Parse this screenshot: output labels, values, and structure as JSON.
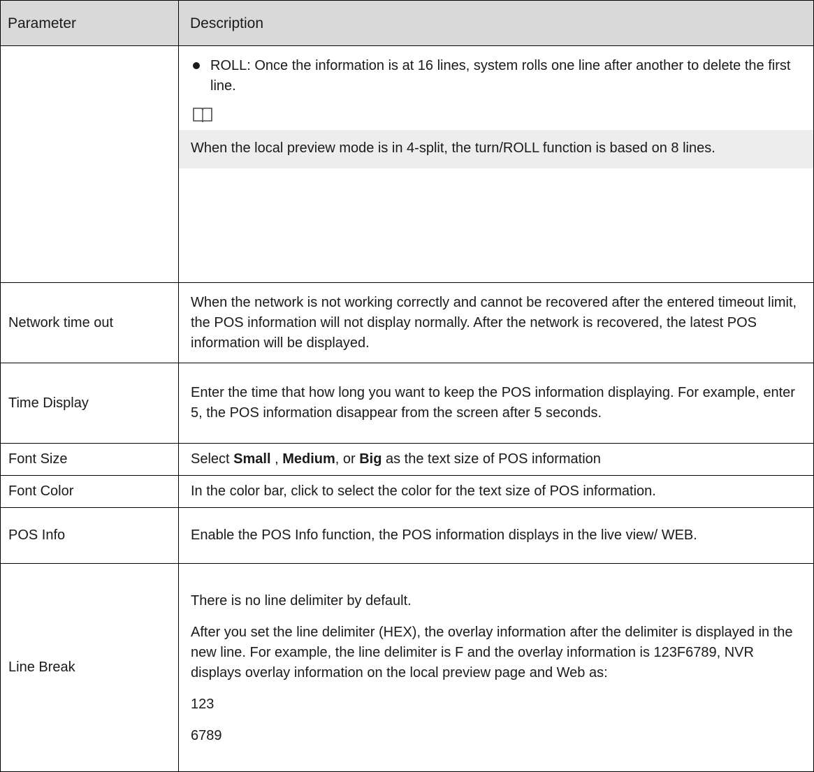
{
  "headers": {
    "parameter": "Parameter",
    "description": "Description"
  },
  "roll_row": {
    "bullet_text": "ROLL: Once the information is at 16 lines, system rolls one line after another to delete the first line.",
    "note_icon": "book-icon",
    "note_text": "When the local preview mode is in 4-split, the turn/ROLL function is based on 8 lines."
  },
  "rows": {
    "network_timeout": {
      "param": "Network time out",
      "desc": "When the network is not working correctly and cannot be recovered after the entered timeout limit, the POS information will not display normally. After the network is recovered, the latest POS information will be displayed."
    },
    "time_display": {
      "param": "Time Display",
      "desc": "Enter the time that how long you want to keep the POS information displaying. For example, enter 5, the POS information disappear from the screen after 5 seconds."
    },
    "font_size": {
      "param": "Font Size",
      "desc_prefix": "Select ",
      "opt_small": "Small",
      "sep1": " , ",
      "opt_medium": "Medium",
      "sep2": ", or ",
      "opt_big": "Big",
      "desc_suffix": " as the text size of POS information"
    },
    "font_color": {
      "param": "Font Color",
      "desc": "In the color bar, click to select the color for the text size of POS information."
    },
    "pos_info": {
      "param": "POS Info",
      "desc": "Enable the POS Info function, the POS information displays in the live view/ WEB."
    },
    "line_break": {
      "param": "Line Break",
      "p1": "There is no line delimiter by default.",
      "p2": "After you set the line delimiter (HEX), the overlay information after the delimiter is displayed in the new line. For example, the line delimiter is F and the overlay information is 123F6789, NVR displays overlay information on the local preview page and Web as:",
      "p3": "123",
      "p4": "6789"
    }
  }
}
